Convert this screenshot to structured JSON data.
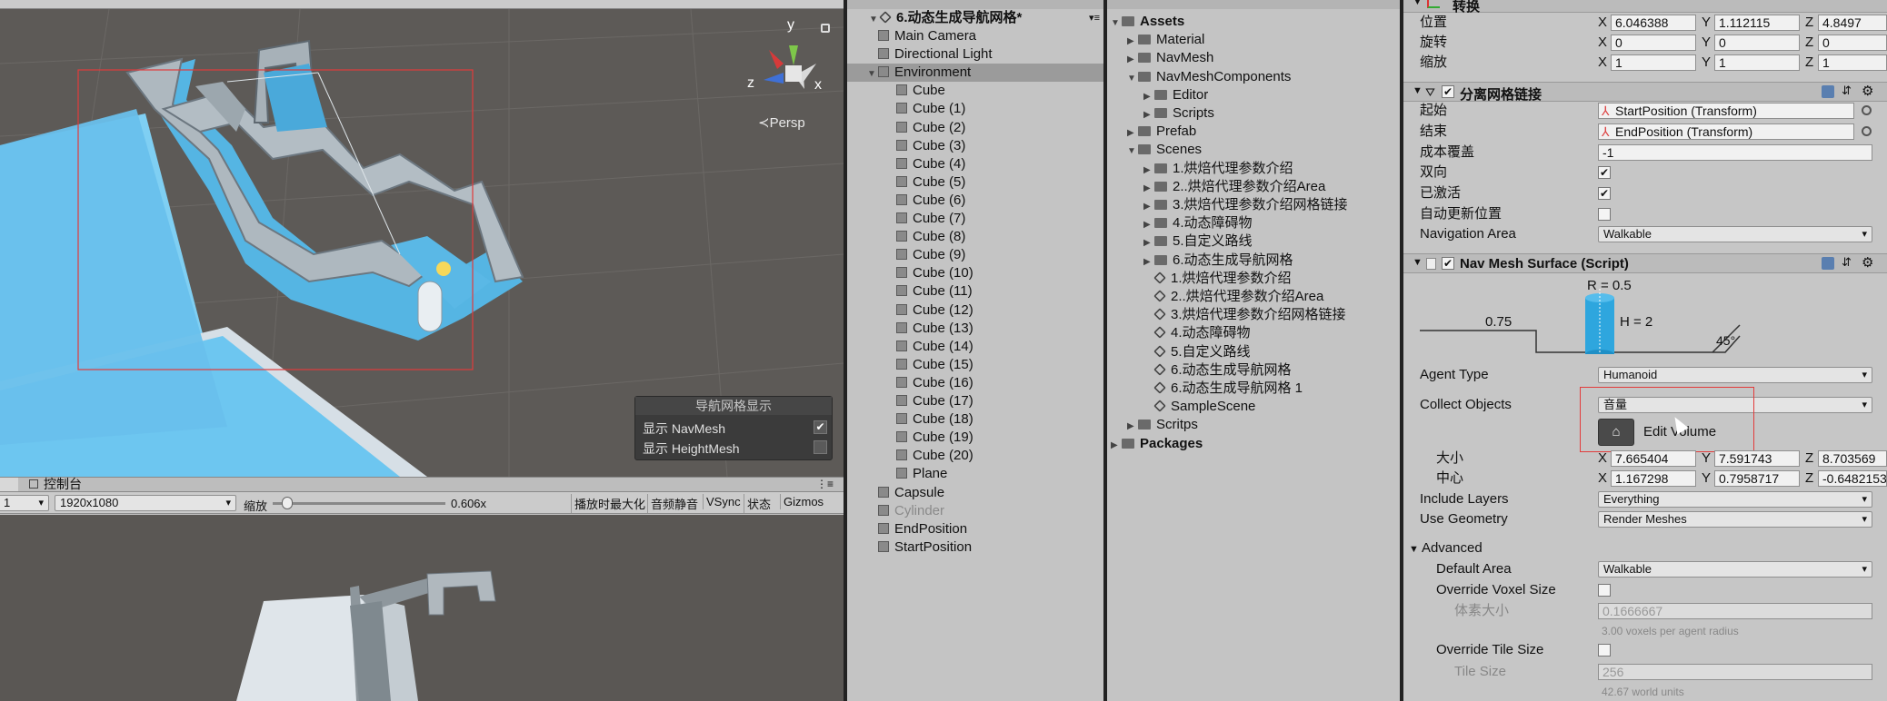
{
  "scene": {
    "persp_label": "≺Persp",
    "gizmo": {
      "y": "y",
      "z": "z",
      "x": "x"
    },
    "overlay": {
      "title": "导航网格显示",
      "items": [
        {
          "label": "显示 NavMesh",
          "checked": true
        },
        {
          "label": "显示 HeightMesh",
          "checked": false
        }
      ]
    }
  },
  "tabs": {
    "console_label": "控制台"
  },
  "game_toolbar": {
    "display": "1",
    "resolution": "1920x1080",
    "scale_label": "缩放",
    "scale_value": "0.606x",
    "maximize": "播放时最大化",
    "mute": "音频静音",
    "vsync": "VSync",
    "stats": "状态",
    "gizmos": "Gizmos"
  },
  "hierarchy": {
    "scene": "6.动态生成导航网格*",
    "items": [
      {
        "name": "Main Camera",
        "depth": 1
      },
      {
        "name": "Directional Light",
        "depth": 1
      },
      {
        "name": "Environment",
        "depth": 1,
        "selected": true
      },
      {
        "name": "Cube",
        "depth": 2
      },
      {
        "name": "Cube (1)",
        "depth": 2
      },
      {
        "name": "Cube (2)",
        "depth": 2
      },
      {
        "name": "Cube (3)",
        "depth": 2
      },
      {
        "name": "Cube (4)",
        "depth": 2
      },
      {
        "name": "Cube (5)",
        "depth": 2
      },
      {
        "name": "Cube (6)",
        "depth": 2
      },
      {
        "name": "Cube (7)",
        "depth": 2
      },
      {
        "name": "Cube (8)",
        "depth": 2
      },
      {
        "name": "Cube (9)",
        "depth": 2
      },
      {
        "name": "Cube (10)",
        "depth": 2
      },
      {
        "name": "Cube (11)",
        "depth": 2
      },
      {
        "name": "Cube (12)",
        "depth": 2
      },
      {
        "name": "Cube (13)",
        "depth": 2
      },
      {
        "name": "Cube (14)",
        "depth": 2
      },
      {
        "name": "Cube (15)",
        "depth": 2
      },
      {
        "name": "Cube (16)",
        "depth": 2
      },
      {
        "name": "Cube (17)",
        "depth": 2
      },
      {
        "name": "Cube (18)",
        "depth": 2
      },
      {
        "name": "Cube (19)",
        "depth": 2
      },
      {
        "name": "Cube (20)",
        "depth": 2
      },
      {
        "name": "Plane",
        "depth": 2
      },
      {
        "name": "Capsule",
        "depth": 1
      },
      {
        "name": "Cylinder",
        "depth": 1,
        "disabled": true
      },
      {
        "name": "EndPosition",
        "depth": 1
      },
      {
        "name": "StartPosition",
        "depth": 1
      }
    ]
  },
  "project": {
    "items": [
      {
        "name": "Assets",
        "depth": 0,
        "type": "folder",
        "open": true,
        "bold": true
      },
      {
        "name": "Material",
        "depth": 1,
        "type": "folder"
      },
      {
        "name": "NavMesh",
        "depth": 1,
        "type": "folder"
      },
      {
        "name": "NavMeshComponents",
        "depth": 1,
        "type": "folder",
        "open": true
      },
      {
        "name": "Editor",
        "depth": 2,
        "type": "folder"
      },
      {
        "name": "Scripts",
        "depth": 2,
        "type": "folder"
      },
      {
        "name": "Prefab",
        "depth": 1,
        "type": "folder"
      },
      {
        "name": "Scenes",
        "depth": 1,
        "type": "folder",
        "open": true
      },
      {
        "name": "1.烘焙代理参数介绍",
        "depth": 2,
        "type": "folder"
      },
      {
        "name": "2..烘焙代理参数介绍Area",
        "depth": 2,
        "type": "folder"
      },
      {
        "name": "3.烘焙代理参数介绍网格链接",
        "depth": 2,
        "type": "folder"
      },
      {
        "name": "4.动态障碍物",
        "depth": 2,
        "type": "folder"
      },
      {
        "name": "5.自定义路线",
        "depth": 2,
        "type": "folder"
      },
      {
        "name": "6.动态生成导航网格",
        "depth": 2,
        "type": "folder"
      },
      {
        "name": "1.烘焙代理参数介绍",
        "depth": 2,
        "type": "scene"
      },
      {
        "name": "2..烘焙代理参数介绍Area",
        "depth": 2,
        "type": "scene"
      },
      {
        "name": "3.烘焙代理参数介绍网格链接",
        "depth": 2,
        "type": "scene"
      },
      {
        "name": "4.动态障碍物",
        "depth": 2,
        "type": "scene"
      },
      {
        "name": "5.自定义路线",
        "depth": 2,
        "type": "scene"
      },
      {
        "name": "6.动态生成导航网格",
        "depth": 2,
        "type": "scene"
      },
      {
        "name": "6.动态生成导航网格 1",
        "depth": 2,
        "type": "scene"
      },
      {
        "name": "SampleScene",
        "depth": 2,
        "type": "scene"
      },
      {
        "name": "Scritps",
        "depth": 1,
        "type": "folder"
      },
      {
        "name": "Packages",
        "depth": 0,
        "type": "folder",
        "bold": true
      }
    ]
  },
  "inspector": {
    "transform": {
      "title": "转换",
      "rows": [
        {
          "label": "位置",
          "x": "6.046388",
          "y": "1.112115",
          "z": "4.8497"
        },
        {
          "label": "旋转",
          "x": "0",
          "y": "0",
          "z": "0"
        },
        {
          "label": "缩放",
          "x": "1",
          "y": "1",
          "z": "1"
        }
      ]
    },
    "offmesh": {
      "title": "分离网格链接",
      "start_label": "起始",
      "start_value": "StartPosition (Transform)",
      "end_label": "结束",
      "end_value": "EndPosition (Transform)",
      "cost_label": "成本覆盖",
      "cost_value": "-1",
      "bidir_label": "双向",
      "bidir_checked": true,
      "activated_label": "已激活",
      "activated_checked": true,
      "autoupdate_label": "自动更新位置",
      "autoupdate_checked": false,
      "area_label": "Navigation Area",
      "area_value": "Walkable"
    },
    "surface": {
      "title": "Nav Mesh Surface (Script)",
      "diagram": {
        "radius": "R = 0.5",
        "height": "H = 2",
        "step": "0.75",
        "slope": "45°"
      },
      "agent_type_label": "Agent Type",
      "agent_type_value": "Humanoid",
      "collect_label": "Collect Objects",
      "collect_value": "音量",
      "edit_volume": "Edit Volume",
      "size_label": "大小",
      "size": {
        "x": "7.665404",
        "y": "7.591743",
        "z": "8.703569"
      },
      "center_label": "中心",
      "center": {
        "x": "1.167298",
        "y": "0.7958717",
        "z": "-0.6482153"
      },
      "layers_label": "Include Layers",
      "layers_value": "Everything",
      "geometry_label": "Use Geometry",
      "geometry_value": "Render Meshes",
      "advanced_label": "Advanced",
      "default_area_label": "Default Area",
      "default_area_value": "Walkable",
      "override_voxel_label": "Override Voxel Size",
      "voxel_size_label": "体素大小",
      "voxel_size_value": "0.1666667",
      "voxel_hint": "3.00 voxels per agent radius",
      "override_tile_label": "Override Tile Size",
      "tile_size_label": "Tile Size",
      "tile_size_value": "256",
      "tile_hint": "42.67 world units"
    }
  },
  "colors": {
    "navmesh": "#5fbde8",
    "selection_rect": "#e23b3b",
    "walls": "#9aa4ab"
  }
}
